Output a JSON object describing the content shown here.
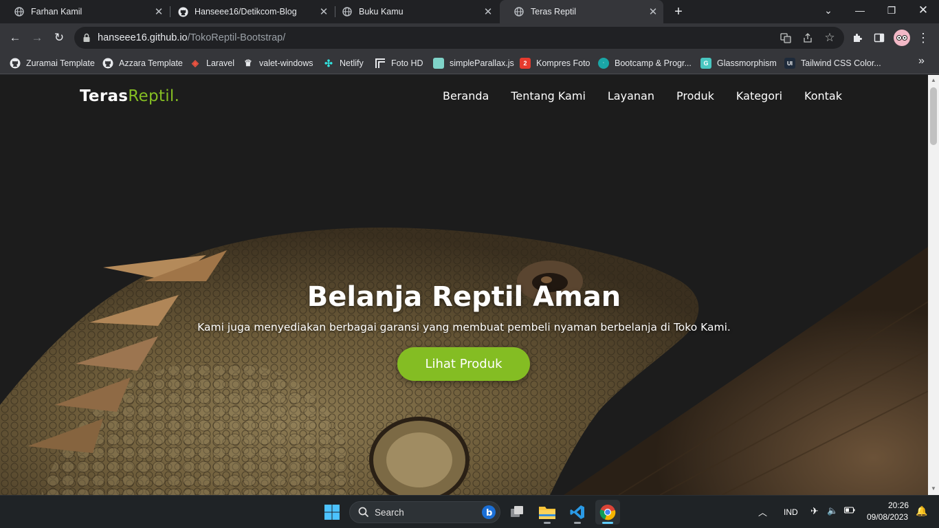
{
  "browser": {
    "tabs": [
      {
        "title": "Farhan Kamil",
        "icon": "globe-icon",
        "active": false
      },
      {
        "title": "Hanseee16/Detikcom-Blog",
        "icon": "github-icon",
        "active": false
      },
      {
        "title": "Buku Kamu",
        "icon": "globe-icon",
        "active": false
      },
      {
        "title": "Teras Reptil",
        "icon": "globe-icon",
        "active": true
      }
    ],
    "url_host": "hanseee16.github.io",
    "url_path": "/TokoReptil-Bootstrap/",
    "bookmarks": [
      {
        "label": "Zuramai Template",
        "icon": "github-icon"
      },
      {
        "label": "Azzara Template",
        "icon": "github-icon"
      },
      {
        "label": "Laravel",
        "icon": "laravel-icon"
      },
      {
        "label": "valet-windows",
        "icon": "valet-icon"
      },
      {
        "label": "Netlify",
        "icon": "netlify-icon"
      },
      {
        "label": "Foto HD",
        "icon": "unsplash-icon"
      },
      {
        "label": "simpleParallax.js",
        "icon": "parallax-icon"
      },
      {
        "label": "Kompres Foto",
        "icon": "compress-icon"
      },
      {
        "label": "Bootcamp & Progr...",
        "icon": "bootcamp-icon"
      },
      {
        "label": "Glassmorphism",
        "icon": "glass-icon"
      },
      {
        "label": "Tailwind CSS Color...",
        "icon": "ui-icon"
      }
    ]
  },
  "site": {
    "logo_part1": "Teras",
    "logo_part2": "Reptil.",
    "nav": [
      "Beranda",
      "Tentang Kami",
      "Layanan",
      "Produk",
      "Kategori",
      "Kontak"
    ],
    "hero_title": "Belanja Reptil Aman",
    "hero_subtitle": "Kami juga menyediakan berbagai garansi yang membuat pembeli nyaman berbelanja di Toko Kami.",
    "hero_button": "Lihat Produk",
    "accent_color": "#84bd23"
  },
  "taskbar": {
    "search_placeholder": "Search",
    "language": "IND",
    "time": "20:26",
    "date": "09/08/2023"
  }
}
